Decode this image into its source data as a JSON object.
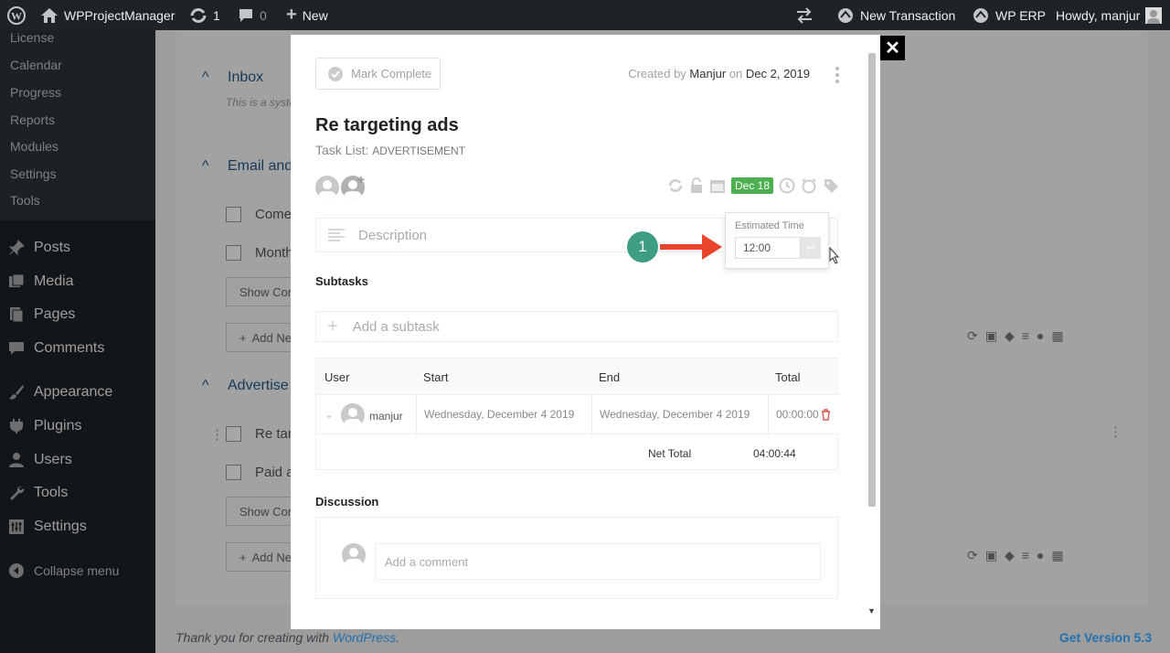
{
  "adminbar": {
    "site_name": "WPProjectManager",
    "updates_count": "1",
    "comments_count": "0",
    "new_label": "New",
    "new_transaction": "New Transaction",
    "wp_erp": "WP ERP",
    "howdy": "Howdy, manjur"
  },
  "sidebar": {
    "submenu": [
      "License",
      "Calendar",
      "Progress",
      "Reports",
      "Modules",
      "Settings",
      "Tools"
    ],
    "items": [
      {
        "label": "Posts",
        "icon": "pin-icon"
      },
      {
        "label": "Media",
        "icon": "media-icon"
      },
      {
        "label": "Pages",
        "icon": "pages-icon"
      },
      {
        "label": "Comments",
        "icon": "comments-icon"
      },
      {
        "label": "Appearance",
        "icon": "brush-icon"
      },
      {
        "label": "Plugins",
        "icon": "plugin-icon"
      },
      {
        "label": "Users",
        "icon": "users-icon"
      },
      {
        "label": "Tools",
        "icon": "wrench-icon"
      },
      {
        "label": "Settings",
        "icon": "settings-icon"
      }
    ],
    "collapse": "Collapse menu"
  },
  "background": {
    "inbox": "Inbox",
    "inbox_desc": "This is a syste",
    "email_list": "Email and",
    "task_1": "Come",
    "task_2": "Month",
    "show_com": "Show Com",
    "add_new": "Add Ne",
    "advert": "Advertise",
    "task_3": "Re tar",
    "task_4": "Paid a"
  },
  "modal": {
    "mark_complete": "Mark Complete",
    "created_by_prefix": "Created by",
    "created_by_user": "Manjur",
    "created_on": "on",
    "created_date": "Dec 2, 2019",
    "title": "Re targeting ads",
    "tasklist_label": "Task List:",
    "tasklist_name": "ADVERTISEMENT",
    "due_badge": "Dec 18",
    "description_placeholder": "Description",
    "estimated_label": "Estimated Time",
    "estimated_value": "12:00",
    "step_number": "1",
    "subtasks_heading": "Subtasks",
    "subtask_placeholder": "Add a subtask",
    "table": {
      "headers": [
        "User",
        "Start",
        "End",
        "Total"
      ],
      "row": {
        "user": "manjur",
        "start": "Wednesday, December 4 2019",
        "end": "Wednesday, December 4 2019",
        "total": "00:00:00"
      },
      "net_total_label": "Net Total",
      "net_total_value": "04:00:44"
    },
    "discussion_heading": "Discussion",
    "comment_placeholder": "Add a comment"
  },
  "footer": {
    "thanks_prefix": "Thank you for creating with",
    "thanks_link": "WordPress",
    "thanks_suffix": ".",
    "version": "Get Version 5.3"
  },
  "colors": {
    "adminbar_bg": "#1d2327",
    "accent": "#2271b1",
    "due_badge": "#4caf50",
    "step_badge": "#3d9e84",
    "arrow": "#e8452c"
  }
}
